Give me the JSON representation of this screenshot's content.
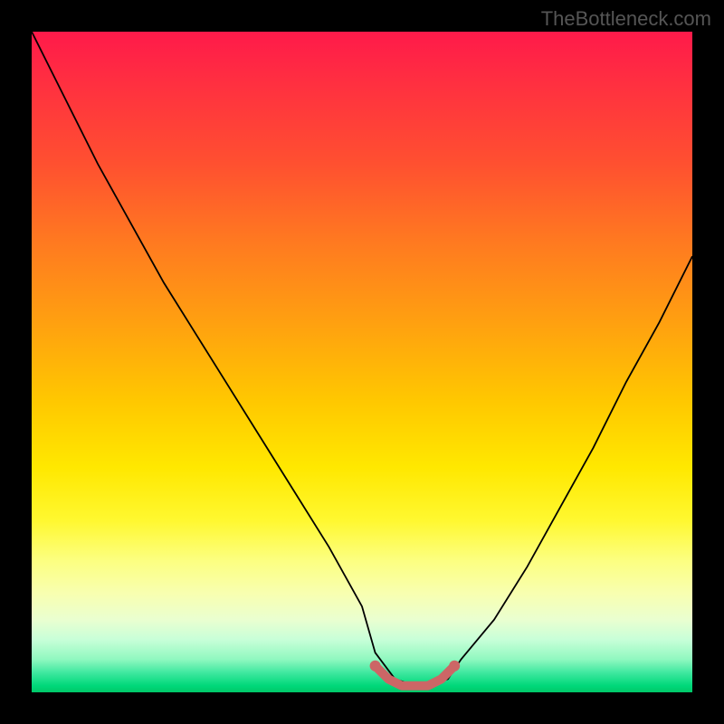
{
  "watermark": "TheBottleneck.com",
  "chart_data": {
    "type": "line",
    "title": "",
    "xlabel": "",
    "ylabel": "",
    "xlim": [
      0,
      100
    ],
    "ylim": [
      0,
      100
    ],
    "series": [
      {
        "name": "curve",
        "x": [
          0,
          5,
          10,
          15,
          20,
          25,
          30,
          35,
          40,
          45,
          50,
          52,
          55,
          58,
          60,
          63,
          65,
          70,
          75,
          80,
          85,
          90,
          95,
          100
        ],
        "y": [
          100,
          90,
          80,
          71,
          62,
          54,
          46,
          38,
          30,
          22,
          13,
          6,
          2,
          1,
          1,
          2,
          5,
          11,
          19,
          28,
          37,
          47,
          56,
          66
        ]
      }
    ],
    "marker_region": {
      "name": "bottom-marker",
      "color": "#cc6666",
      "x": [
        52,
        54,
        56,
        58,
        60,
        62,
        64
      ],
      "y": [
        4,
        2,
        1,
        1,
        1,
        2,
        4
      ]
    },
    "background_gradient": {
      "stops": [
        {
          "pos": 0,
          "color": "#ff1a4a"
        },
        {
          "pos": 50,
          "color": "#ffc800"
        },
        {
          "pos": 80,
          "color": "#fcff80"
        },
        {
          "pos": 100,
          "color": "#00c868"
        }
      ]
    }
  }
}
